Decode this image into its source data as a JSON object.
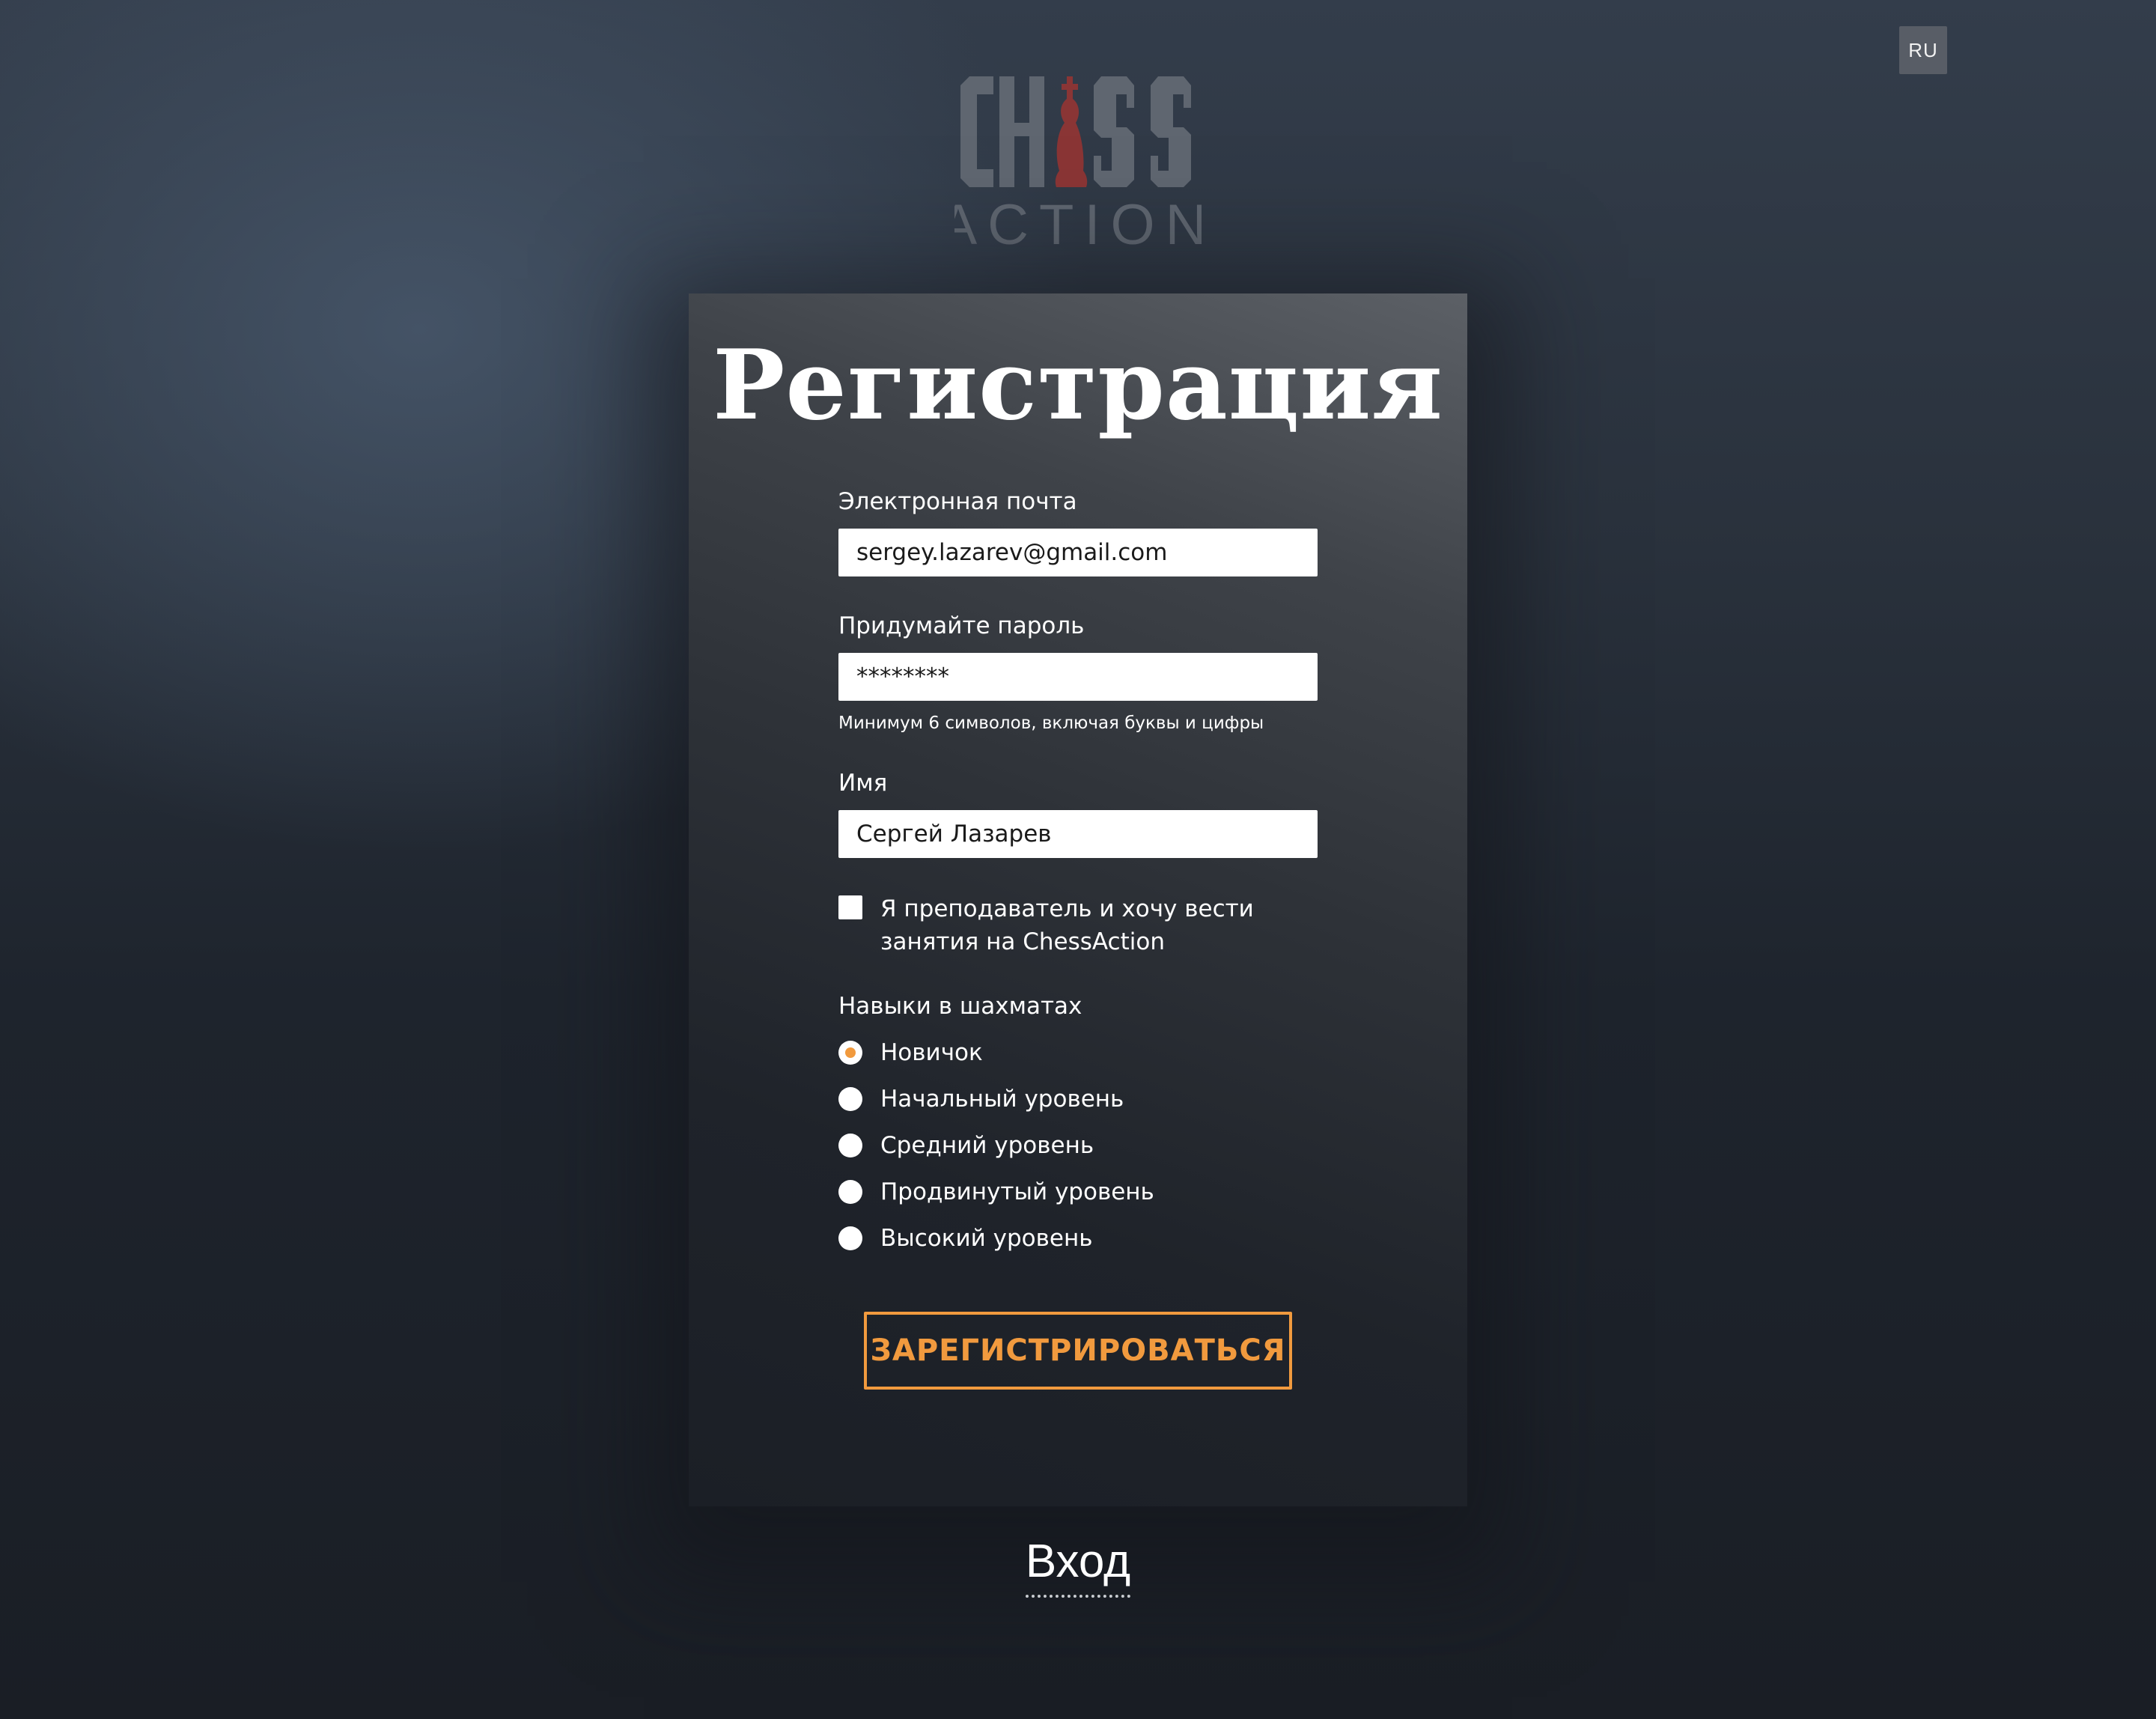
{
  "language_switch": {
    "label": "RU"
  },
  "logo": {
    "top_text": "CHESS",
    "bottom_text": "ACTION"
  },
  "form": {
    "title": "Регистрация",
    "email": {
      "label": "Электронная почта",
      "value": "sergey.lazarev@gmail.com"
    },
    "password": {
      "label": "Придумайте пароль",
      "value": "********",
      "hint": "Минимум 6 символов, включая буквы и цифры"
    },
    "name": {
      "label": "Имя",
      "value": "Сергей Лазарев"
    },
    "teacher_checkbox": {
      "label": "Я преподаватель и хочу вести занятия на ChessAction",
      "checked": false
    },
    "skills": {
      "label": "Навыки в шахматах",
      "options": [
        {
          "label": "Новичок",
          "selected": true
        },
        {
          "label": "Начальный уровень",
          "selected": false
        },
        {
          "label": "Средний уровень",
          "selected": false
        },
        {
          "label": "Продвинутый уровень",
          "selected": false
        },
        {
          "label": "Высокий уровень",
          "selected": false
        }
      ]
    },
    "submit_label": "ЗАРЕГИСТРИРОВАТЬСЯ"
  },
  "login_link": {
    "label": "Вход"
  },
  "colors": {
    "accent": "#f19a3e",
    "logo_gray": "#5f6670",
    "logo_red": "#8a3535",
    "input_bg": "#ffffff"
  }
}
